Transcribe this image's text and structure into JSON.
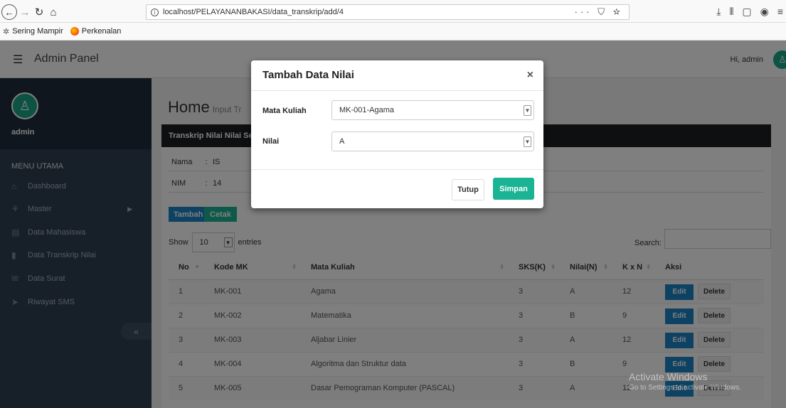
{
  "browser": {
    "url": "localhost/PELAYANANBAKASI/data_transkrip/add/4",
    "url_actions": "··· ⛉ ☆",
    "bookmarks": [
      {
        "label": "Sering Mampir"
      },
      {
        "label": "Perkenalan"
      }
    ]
  },
  "header": {
    "title": "Admin Panel",
    "greeting": "Hi, admin"
  },
  "sidebar": {
    "username": "admin",
    "menu_heading": "MENU UTAMA",
    "items": [
      {
        "label": "Dashboard",
        "icon": "home-icon"
      },
      {
        "label": "Master",
        "icon": "sitemap-icon",
        "has_submenu": true
      },
      {
        "label": "Data Mahasiswa",
        "icon": "id-card-icon"
      },
      {
        "label": "Data Transkrip Nilai",
        "icon": "file-icon"
      },
      {
        "label": "Data Surat",
        "icon": "envelope-icon"
      },
      {
        "label": "Riwayat SMS",
        "icon": "paper-plane-icon"
      }
    ],
    "collapse_label": "«"
  },
  "main": {
    "page_title": "Home",
    "page_subtitle": "Input Tr",
    "panel_title": "Transkrip Nilai Nilai Se",
    "info": [
      {
        "label": "Nama",
        "sep": ":",
        "value": "IS"
      },
      {
        "label": "NIM",
        "sep": ":",
        "value": "14"
      }
    ],
    "buttons": {
      "tambah": "Tambah",
      "cetak": "Cetak"
    },
    "show_label": "Show",
    "entries_value": "10",
    "entries_label": "entries",
    "search_label": "Search:",
    "table": {
      "columns": [
        "No",
        "Kode MK",
        "Mata Kuliah",
        "SKS(K)",
        "Nilai(N)",
        "K x N",
        "Aksi"
      ],
      "rows": [
        {
          "no": "1",
          "kode": "MK-001",
          "mk": "Agama",
          "sks": "3",
          "nilai": "A",
          "kxn": "12"
        },
        {
          "no": "2",
          "kode": "MK-002",
          "mk": "Matematika",
          "sks": "3",
          "nilai": "B",
          "kxn": "9"
        },
        {
          "no": "3",
          "kode": "MK-003",
          "mk": "Aljabar Linier",
          "sks": "3",
          "nilai": "A",
          "kxn": "12"
        },
        {
          "no": "4",
          "kode": "MK-004",
          "mk": "Algoritma dan Struktur data",
          "sks": "3",
          "nilai": "B",
          "kxn": "9"
        },
        {
          "no": "5",
          "kode": "MK-005",
          "mk": "Dasar Pemograman Komputer (PASCAL)",
          "sks": "3",
          "nilai": "A",
          "kxn": "12"
        }
      ],
      "edit_label": "Edit",
      "delete_label": "Delete"
    }
  },
  "modal": {
    "title": "Tambah Data Nilai",
    "close": "×",
    "fields": [
      {
        "label": "Mata Kuliah",
        "value": "MK-001-Agama"
      },
      {
        "label": "Nilai",
        "value": "A"
      }
    ],
    "tutup": "Tutup",
    "simpan": "Simpan"
  },
  "watermark": {
    "line1": "Activate Windows",
    "line2": "Go to Settings to activate Windows."
  },
  "colors": {
    "sidebar_bg": "#2f4050",
    "primary": "#1c84c6",
    "success": "#1ab394",
    "panel_header": "#1c1f23"
  }
}
